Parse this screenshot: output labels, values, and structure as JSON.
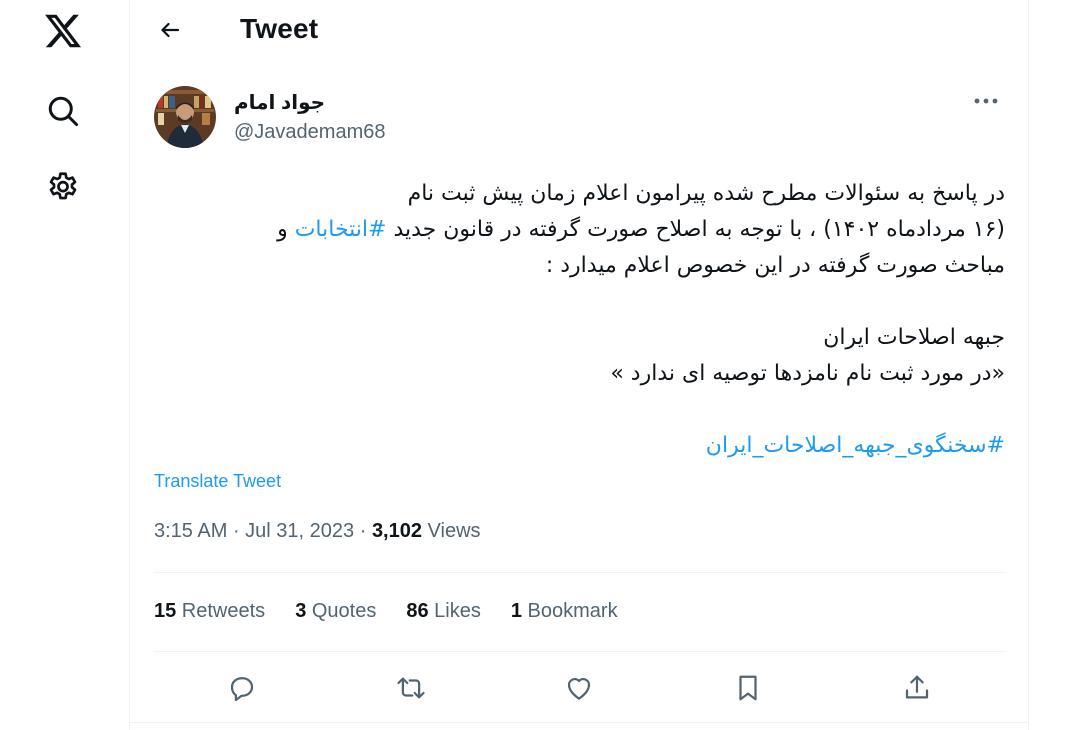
{
  "header": {
    "title": "Tweet"
  },
  "nav": {
    "logo_icon": "x-logo-icon",
    "search_icon": "search-icon",
    "settings_icon": "gear-icon"
  },
  "author": {
    "name": "جواد امام",
    "handle": "@Javademam68"
  },
  "tweet": {
    "line1": "در پاسخ به سئوالات مطرح شده پیرامون اعلام زمان پیش ثبت نام",
    "line2_pre": "(۱۶ مردادماه ۱۴۰۲) ، با توجه به اصلاح  صورت گرفته در قانون جدید ",
    "line2_hashtag": "#انتخابات",
    "line2_post": " و",
    "line3": "مباحث صورت گرفته در این خصوص اعلام میدارد :",
    "line4": "جبهه اصلاحات ایران",
    "line5": "«در مورد ثبت نام نامزدها توصیه ای ندارد »",
    "hashtag2": "#سخنگوی_جبهه_اصلاحات_ایران"
  },
  "translate_label": "Translate Tweet",
  "meta": {
    "time": "3:15 AM",
    "sep1": " · ",
    "date": "Jul 31, 2023",
    "sep2": " · ",
    "views_count": "3,102",
    "views_label": " Views"
  },
  "stats": {
    "retweets_count": "15",
    "retweets_label": " Retweets",
    "quotes_count": "3",
    "quotes_label": " Quotes",
    "likes_count": "86",
    "likes_label": " Likes",
    "bookmarks_count": "1",
    "bookmarks_label": " Bookmark"
  },
  "colors": {
    "accent": "#1d9bf0",
    "text": "#0f1419",
    "secondary": "#536471",
    "border": "#eff3f4"
  }
}
